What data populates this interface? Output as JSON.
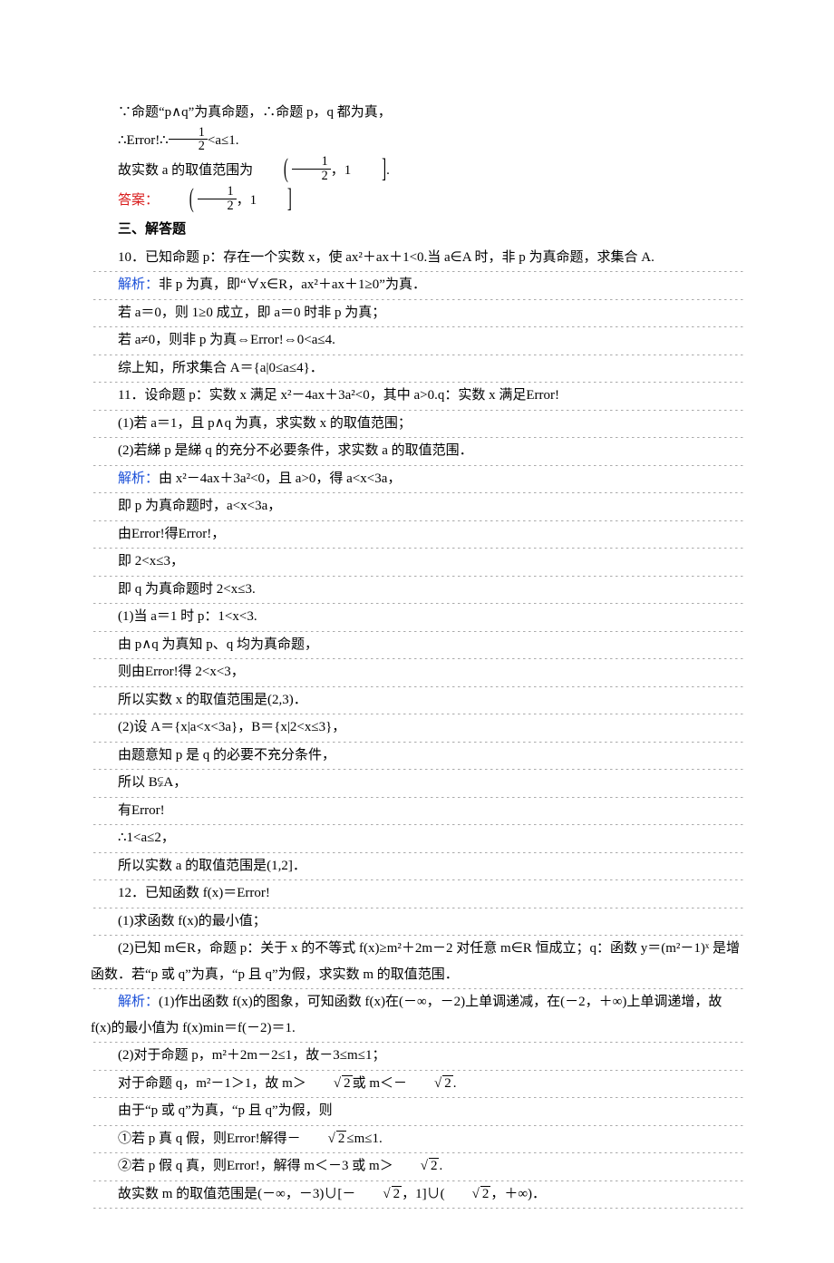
{
  "l1": "∵命题“p∧q”为真命题，∴命题 p，q 都为真，",
  "l2a": "∴Error!∴",
  "l2b": "<a≤1.",
  "l3a": "故实数 a 的取值范围为",
  "interval": {
    "open": "(",
    "a": "1",
    "b": "2",
    "mid": "，1",
    "close": "]"
  },
  "l4a": "答案：",
  "h3": "三、解答题",
  "l5": "10．已知命题 p：存在一个实数 x，使 ax²＋ax＋1<0.当 a∈A 时，非 p 为真命题，求集合 A.",
  "l6a": "解析：",
  "l6b": "非 p 为真，即“∀x∈R，ax²＋ax＋1≥0”为真．",
  "l7": "若 a＝0，则 1≥0 成立，即 a＝0 时非 p 为真；",
  "l8": "若 a≠0，则非 p 为真⇔Error!⇔0<a≤4.",
  "l9": "综上知，所求集合 A＝{a|0≤a≤4}．",
  "l10": "11．设命题 p：实数 x 满足 x²－4ax＋3a²<0，其中 a>0.q：实数 x 满足Error!",
  "l11": "(1)若 a＝1，且 p∧q 为真，求实数 x 的取值范围；",
  "l12": "(2)若綈 p 是綈 q 的充分不必要条件，求实数 a 的取值范围．",
  "l13a": "解析：",
  "l13b": "由 x²－4ax＋3a²<0，且 a>0，得 a<x<3a，",
  "l14": "即 p 为真命题时，a<x<3a，",
  "l15": "由Error!得Error!，",
  "l16": "即 2<x≤3，",
  "l17": "即 q 为真命题时 2<x≤3.",
  "l18": "(1)当 a＝1 时 p：1<x<3.",
  "l19": "由 p∧q 为真知 p、q 均为真命题，",
  "l20": "则由Error!得 2<x<3，",
  "l21": "所以实数 x 的取值范围是(2,3)．",
  "l22": "(2)设 A＝{x|a<x<3a}，B＝{x|2<x≤3}，",
  "l23": "由题意知 p 是 q 的必要不充分条件，",
  "l24": "所以 B⫋A，",
  "l25": "有Error!",
  "l26": "∴1<a≤2，",
  "l27": "所以实数 a 的取值范围是(1,2]．",
  "l28": "12．已知函数 f(x)＝Error!",
  "l29": "(1)求函数 f(x)的最小值；",
  "l30": "(2)已知 m∈R，命题 p：关于 x 的不等式 f(x)≥m²＋2m－2 对任意 m∈R 恒成立；q：函数 y＝(m²－1)ˣ 是增函数．若“p 或 q”为真，“p 且 q”为假，求实数 m 的取值范围．",
  "l31a": "解析：",
  "l31b": "(1)作出函数 f(x)的图象，可知函数 f(x)在(－∞，－2)上单调递减，在(－2，＋∞)上单调递增，故 f(x)的最小值为 f(x)min＝f(－2)＝1.",
  "l32": "(2)对于命题 p，m²＋2m－2≤1，故－3≤m≤1；",
  "l33a": "对于命题 q，m²－1＞1，故 m＞",
  "l33m": "或 m＜－",
  "l33e": ".",
  "l34": "由于“p 或 q”为真，“p 且 q”为假，则",
  "l35a": "①若 p 真 q 假，则Error!解得－",
  "l35b": "≤m≤1.",
  "l36a": "②若 p 假 q 真，则Error!，解得 m＜－3 或 m＞",
  "l36b": ".",
  "l37a": "故实数 m 的取值范围是(－∞，－3)∪[－",
  "l37b": "，1]∪(",
  "l37c": "，＋∞)．",
  "sqrt2": "2"
}
